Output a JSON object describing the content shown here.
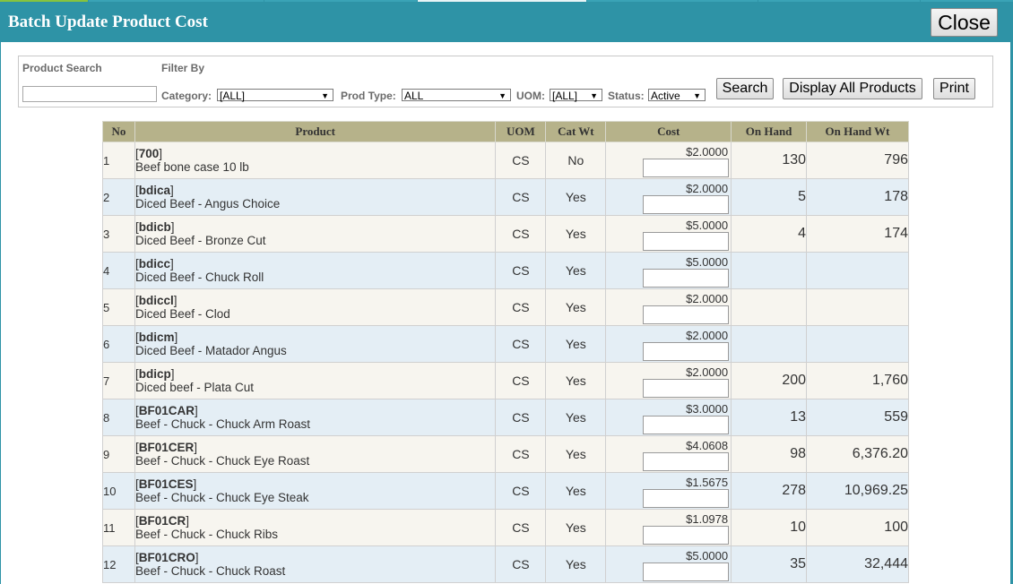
{
  "window": {
    "title": "Batch Update Product Cost",
    "close_label": "Close"
  },
  "filters": {
    "product_search_label": "Product Search",
    "filter_by_label": "Filter By",
    "search_value": "",
    "category_label": "Category:",
    "category_value": "[ALL]",
    "prod_type_label": "Prod Type:",
    "prod_type_value": "ALL",
    "uom_label": "UOM:",
    "uom_value": "[ALL]",
    "status_label": "Status:",
    "status_value": "Active",
    "search_button": "Search",
    "display_all_button": "Display All Products",
    "print_button": "Print"
  },
  "table": {
    "headers": {
      "no": "No",
      "product": "Product",
      "uom": "UOM",
      "catwt": "Cat Wt",
      "cost": "Cost",
      "onhand": "On Hand",
      "onhandwt": "On Hand Wt"
    },
    "rows": [
      {
        "no": "1",
        "code": "700",
        "name": "Beef bone case 10 lb",
        "uom": "CS",
        "catwt": "No",
        "cost": "$2.0000",
        "onhand": "130",
        "onhandwt": "796"
      },
      {
        "no": "2",
        "code": "bdica",
        "name": "Diced Beef - Angus Choice",
        "uom": "CS",
        "catwt": "Yes",
        "cost": "$2.0000",
        "onhand": "5",
        "onhandwt": "178"
      },
      {
        "no": "3",
        "code": "bdicb",
        "name": "Diced Beef - Bronze Cut",
        "uom": "CS",
        "catwt": "Yes",
        "cost": "$5.0000",
        "onhand": "4",
        "onhandwt": "174"
      },
      {
        "no": "4",
        "code": "bdicc",
        "name": "Diced Beef - Chuck Roll",
        "uom": "CS",
        "catwt": "Yes",
        "cost": "$5.0000",
        "onhand": "",
        "onhandwt": ""
      },
      {
        "no": "5",
        "code": "bdiccl",
        "name": "Diced Beef - Clod",
        "uom": "CS",
        "catwt": "Yes",
        "cost": "$2.0000",
        "onhand": "",
        "onhandwt": ""
      },
      {
        "no": "6",
        "code": "bdicm",
        "name": "Diced Beef - Matador Angus",
        "uom": "CS",
        "catwt": "Yes",
        "cost": "$2.0000",
        "onhand": "",
        "onhandwt": ""
      },
      {
        "no": "7",
        "code": "bdicp",
        "name": "Diced beef - Plata Cut",
        "uom": "CS",
        "catwt": "Yes",
        "cost": "$2.0000",
        "onhand": "200",
        "onhandwt": "1,760"
      },
      {
        "no": "8",
        "code": "BF01CAR",
        "name": "Beef - Chuck - Chuck Arm Roast",
        "uom": "CS",
        "catwt": "Yes",
        "cost": "$3.0000",
        "onhand": "13",
        "onhandwt": "559"
      },
      {
        "no": "9",
        "code": "BF01CER",
        "name": "Beef - Chuck - Chuck Eye Roast",
        "uom": "CS",
        "catwt": "Yes",
        "cost": "$4.0608",
        "onhand": "98",
        "onhandwt": "6,376.20"
      },
      {
        "no": "10",
        "code": "BF01CES",
        "name": "Beef - Chuck - Chuck Eye Steak",
        "uom": "CS",
        "catwt": "Yes",
        "cost": "$1.5675",
        "onhand": "278",
        "onhandwt": "10,969.25"
      },
      {
        "no": "11",
        "code": "BF01CR",
        "name": "Beef - Chuck - Chuck Ribs",
        "uom": "CS",
        "catwt": "Yes",
        "cost": "$1.0978",
        "onhand": "10",
        "onhandwt": "100"
      },
      {
        "no": "12",
        "code": "BF01CRO",
        "name": "Beef - Chuck - Chuck Roast",
        "uom": "CS",
        "catwt": "Yes",
        "cost": "$5.0000",
        "onhand": "35",
        "onhandwt": "32,444"
      }
    ]
  }
}
